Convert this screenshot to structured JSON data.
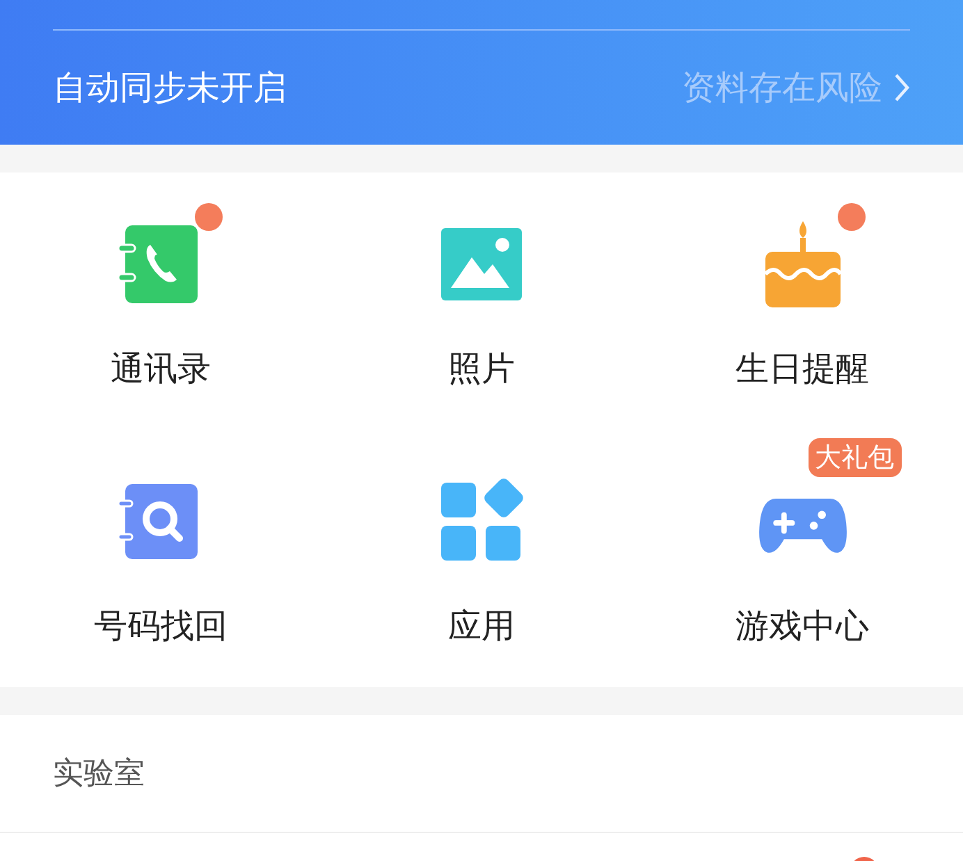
{
  "sync_bar": {
    "status": "自动同步未开启",
    "warning": "资料存在风险"
  },
  "features": [
    {
      "label": "通讯录",
      "badge": {
        "kind": "dot"
      }
    },
    {
      "label": "照片"
    },
    {
      "label": "生日提醒",
      "badge": {
        "kind": "dot"
      }
    },
    {
      "label": "号码找回"
    },
    {
      "label": "应用"
    },
    {
      "label": "游戏中心",
      "badge": {
        "kind": "label",
        "text": "大礼包"
      }
    }
  ],
  "lab_section": {
    "title": "实验室"
  },
  "next_row": {
    "badge": {
      "kind": "dot"
    }
  }
}
